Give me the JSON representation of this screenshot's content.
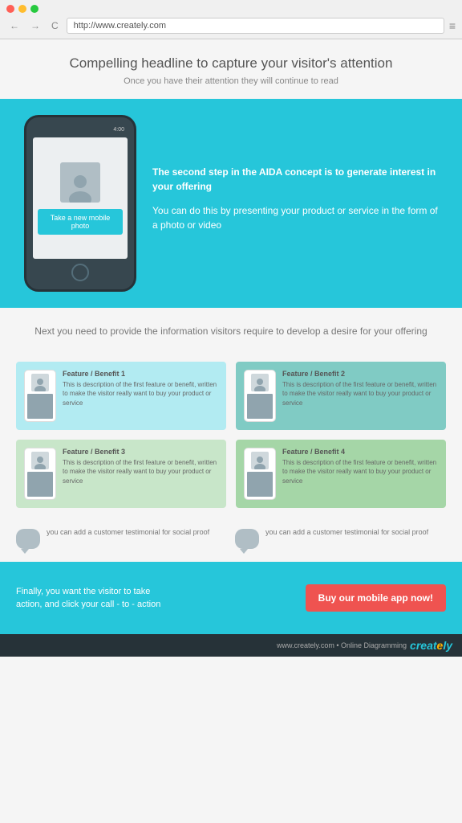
{
  "browser": {
    "url": "http://www.creately.com",
    "nav_back": "←",
    "nav_forward": "→",
    "nav_refresh": "C",
    "menu_icon": "≡"
  },
  "header": {
    "headline": "Compelling headline to capture your visitor's attention",
    "subheadline": "Once you have their attention they will continue to read"
  },
  "hero": {
    "phone_time": "4:00",
    "phone_cta": "Take a new mobile photo",
    "text1_bold": "The second step in the AIDA concept is to generate interest in your offering",
    "text2": "You can do this by presenting your product or service in the form of a photo or video"
  },
  "desire": {
    "text": "Next you need to provide the information visitors require to develop a desire for your offering"
  },
  "features": [
    {
      "title": "Feature / Benefit 1",
      "desc": "This is description of the first feature or benefit, written to make the visitor really want to buy your product or service",
      "card_class": "card-blue"
    },
    {
      "title": "Feature / Benefit 2",
      "desc": "This is description of the first feature or benefit, written to make the visitor really want to buy your product or service",
      "card_class": "card-teal"
    },
    {
      "title": "Feature / Benefit 3",
      "desc": "This is description of the first feature or benefit, written to make the visitor really want to buy your product or service",
      "card_class": "card-green"
    },
    {
      "title": "Feature / Benefit 4",
      "desc": "This is description of the first feature or benefit, written to make the visitor really want to buy your product or service",
      "card_class": "card-mint"
    }
  ],
  "testimonials": [
    {
      "text": "you can add a customer testimonial for social proof"
    },
    {
      "text": "you can add a customer testimonial for social proof"
    }
  ],
  "cta": {
    "left_text": "Finally, you want the visitor to take action, and click your call - to - action",
    "button_label": "Buy our mobile app now!"
  },
  "brand": {
    "footer_text": "www.creately.com • Online Diagramming",
    "logo": "creately"
  }
}
